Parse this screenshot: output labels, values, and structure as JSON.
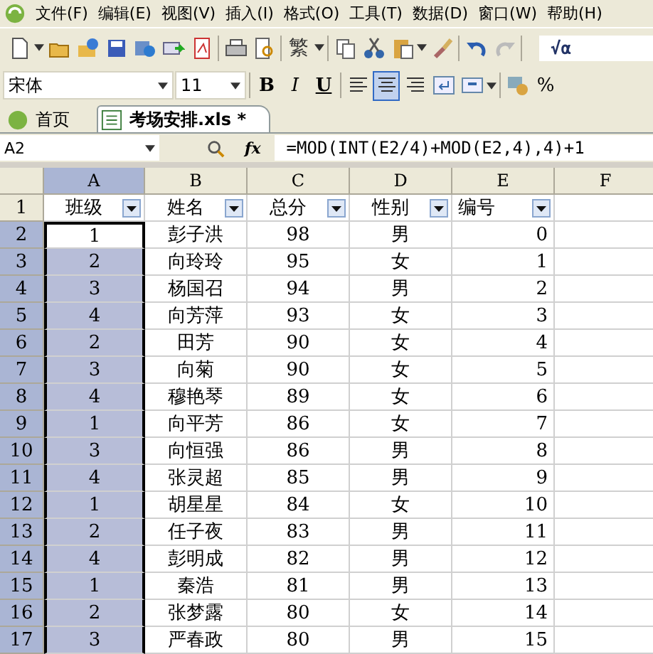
{
  "menu_bar": [
    "文件(F)",
    "编辑(E)",
    "视图(V)",
    "插入(I)",
    "格式(O)",
    "工具(T)",
    "数据(D)",
    "窗口(W)",
    "帮助(H)"
  ],
  "toolbar": {
    "convert_label": "繁",
    "formula_label": "√α"
  },
  "format_bar": {
    "font": "宋体",
    "size": "11",
    "bold": "B",
    "italic": "I",
    "underline": "U",
    "percent": "%",
    "align_center_selected": true
  },
  "tabs": [
    {
      "label": "首页",
      "selected": false
    },
    {
      "label": "考场安排.xls *",
      "selected": true
    }
  ],
  "formula_bar": {
    "name_box": "A2",
    "fx": "fx",
    "formula": "=MOD(INT(E2/4)+MOD(E2,4),4)+1"
  },
  "sheet": {
    "columns": [
      {
        "label": "A",
        "selected": true
      },
      {
        "label": "B",
        "selected": false
      },
      {
        "label": "C",
        "selected": false
      },
      {
        "label": "D",
        "selected": false
      },
      {
        "label": "E",
        "selected": false
      },
      {
        "label": "F",
        "selected": false
      }
    ],
    "header_row": {
      "number": "1",
      "selected": false,
      "cells": [
        "班级",
        "姓名",
        "总分",
        "性别",
        "编号"
      ]
    },
    "rows": [
      {
        "number": "2",
        "selected": true,
        "active": true,
        "cells": [
          "1",
          "彭子洪",
          "98",
          "男",
          "0"
        ]
      },
      {
        "number": "3",
        "selected": true,
        "active": false,
        "cells": [
          "2",
          "向玲玲",
          "95",
          "女",
          "1"
        ]
      },
      {
        "number": "4",
        "selected": true,
        "active": false,
        "cells": [
          "3",
          "杨国召",
          "94",
          "男",
          "2"
        ]
      },
      {
        "number": "5",
        "selected": true,
        "active": false,
        "cells": [
          "4",
          "向芳萍",
          "93",
          "女",
          "3"
        ]
      },
      {
        "number": "6",
        "selected": true,
        "active": false,
        "cells": [
          "2",
          "田芳",
          "90",
          "女",
          "4"
        ]
      },
      {
        "number": "7",
        "selected": true,
        "active": false,
        "cells": [
          "3",
          "向菊",
          "90",
          "女",
          "5"
        ]
      },
      {
        "number": "8",
        "selected": true,
        "active": false,
        "cells": [
          "4",
          "穆艳琴",
          "89",
          "女",
          "6"
        ]
      },
      {
        "number": "9",
        "selected": true,
        "active": false,
        "cells": [
          "1",
          "向平芳",
          "86",
          "女",
          "7"
        ]
      },
      {
        "number": "10",
        "selected": true,
        "active": false,
        "cells": [
          "3",
          "向恒强",
          "86",
          "男",
          "8"
        ]
      },
      {
        "number": "11",
        "selected": true,
        "active": false,
        "cells": [
          "4",
          "张灵超",
          "85",
          "男",
          "9"
        ]
      },
      {
        "number": "12",
        "selected": true,
        "active": false,
        "cells": [
          "1",
          "胡星星",
          "84",
          "女",
          "10"
        ]
      },
      {
        "number": "13",
        "selected": true,
        "active": false,
        "cells": [
          "2",
          "任子夜",
          "83",
          "男",
          "11"
        ]
      },
      {
        "number": "14",
        "selected": true,
        "active": false,
        "cells": [
          "4",
          "彭明成",
          "82",
          "男",
          "12"
        ]
      },
      {
        "number": "15",
        "selected": true,
        "active": false,
        "cells": [
          "1",
          "秦浩",
          "81",
          "男",
          "13"
        ]
      },
      {
        "number": "16",
        "selected": true,
        "active": false,
        "cells": [
          "2",
          "张梦露",
          "80",
          "女",
          "14"
        ]
      },
      {
        "number": "17",
        "selected": true,
        "active": false,
        "cells": [
          "3",
          "严春政",
          "80",
          "男",
          "15"
        ]
      }
    ]
  }
}
